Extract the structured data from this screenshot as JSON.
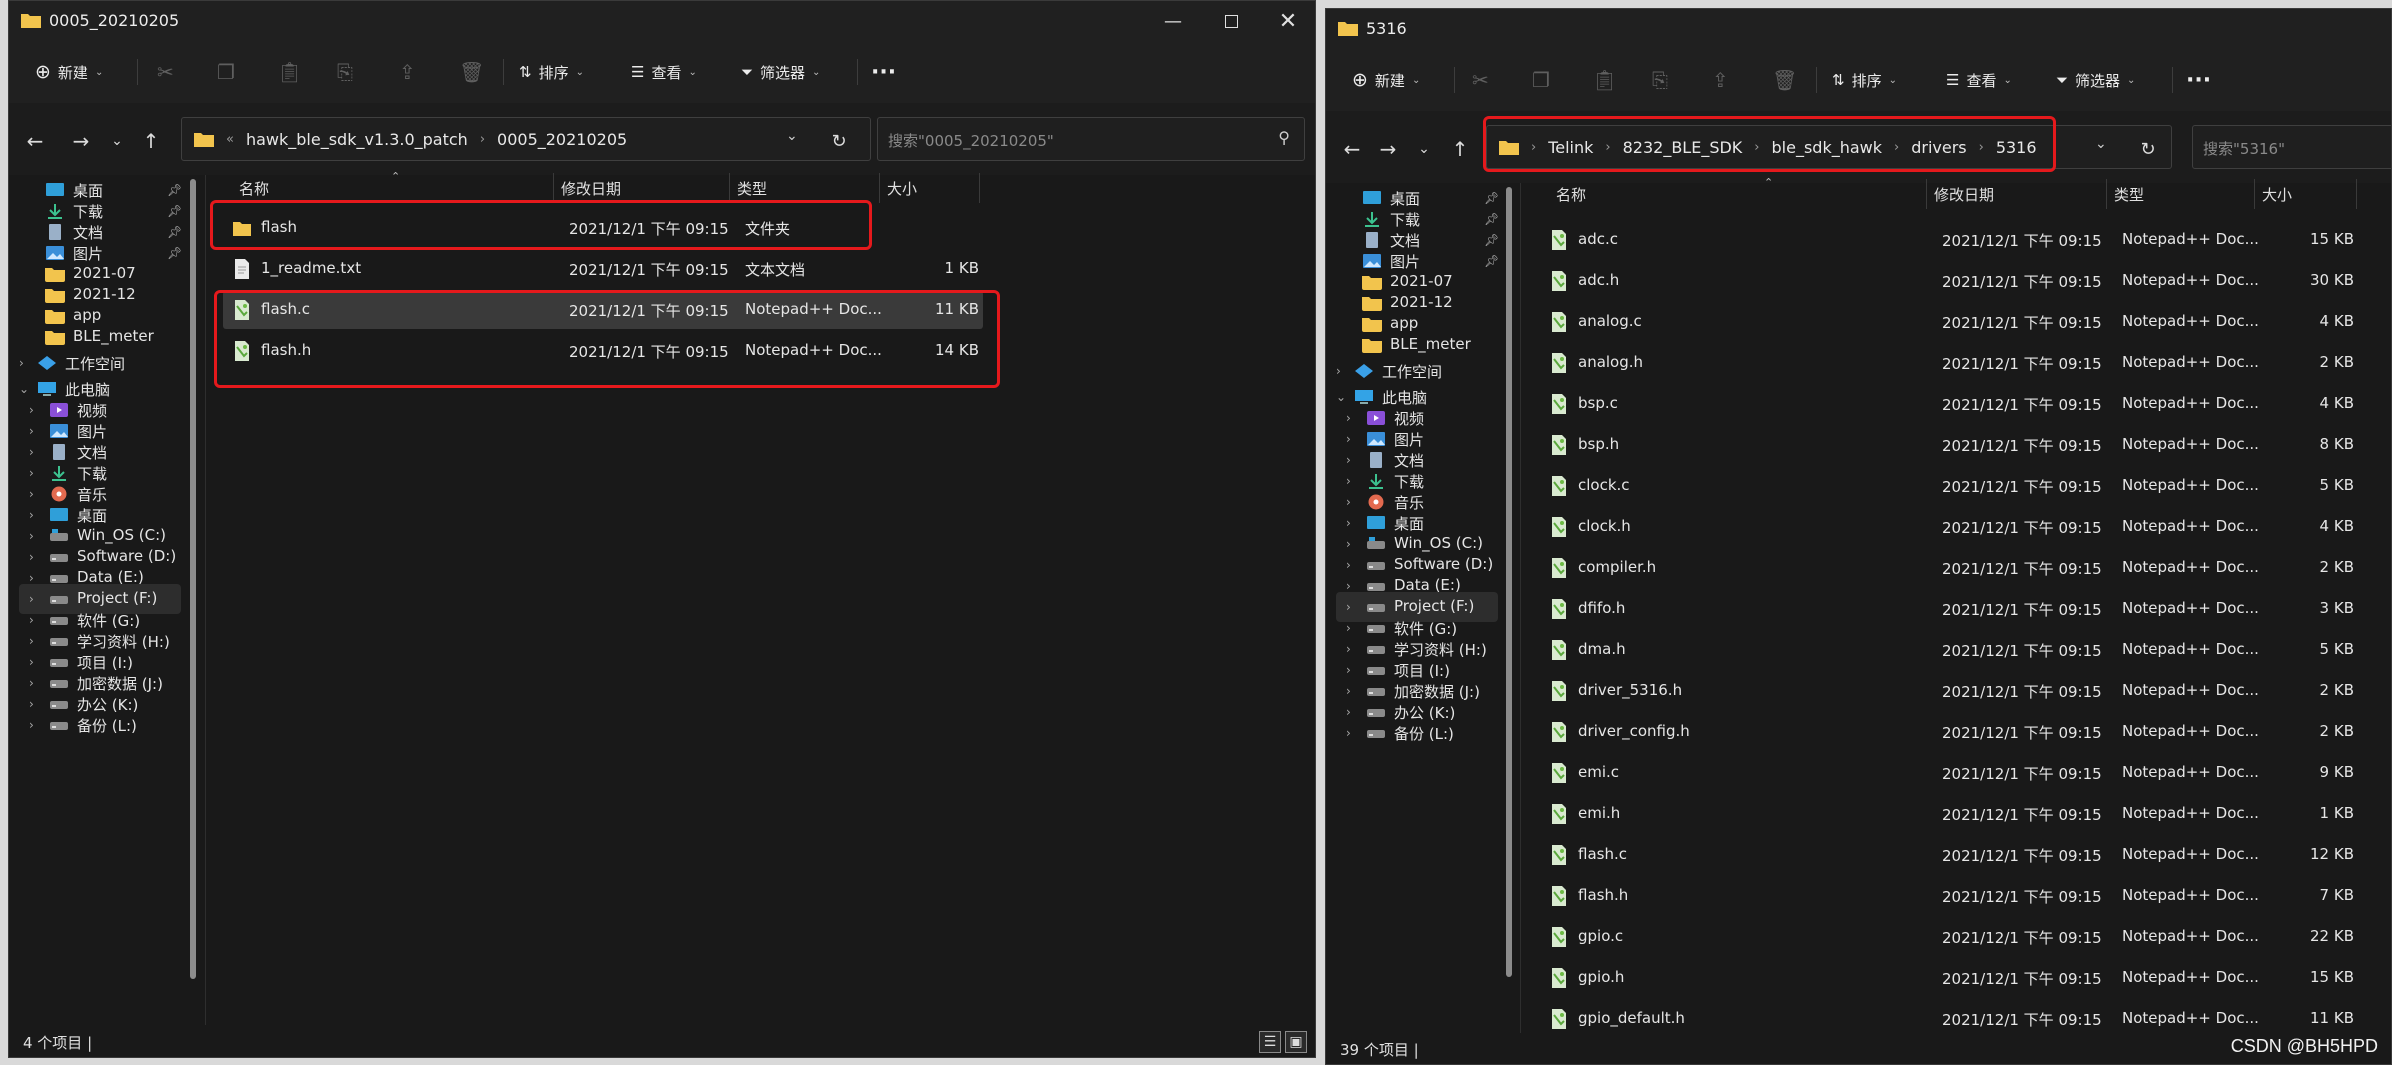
{
  "colors": {
    "window_bg": "#191919",
    "toolbar_bg": "#202020",
    "highlight_border": "#e5191c",
    "folder_yellow": "#f2c44d",
    "selection_bg": "#3a3a3a"
  },
  "left_window": {
    "title": "0005_20210205",
    "title_icon": "folder-icon",
    "window_controls": [
      "minimize-icon",
      "maximize-icon",
      "close-icon"
    ],
    "toolbar": {
      "new_label": "新建",
      "sort_label": "排序",
      "view_label": "查看",
      "filter_label": "筛选器",
      "more_label": "···",
      "disabled_icons": [
        "cut-icon",
        "copy-icon",
        "paste-icon",
        "rename-icon",
        "share-icon",
        "delete-icon"
      ]
    },
    "nav": {
      "back_icon": "arrow-left-icon",
      "forward_icon": "arrow-right-icon",
      "recent_icon": "chevron-down-icon",
      "up_icon": "arrow-up-icon"
    },
    "address": {
      "overflow": "«",
      "crumbs": [
        "hawk_ble_sdk_v1.3.0_patch",
        "0005_20210205"
      ],
      "refresh_icon": "refresh-icon"
    },
    "search": {
      "placeholder": "搜索\"0005_20210205\"",
      "icon": "search-icon"
    },
    "sidebar": [
      {
        "label": "桌面",
        "icon": "desktop-icon",
        "pinned": true
      },
      {
        "label": "下载",
        "icon": "download-icon",
        "pinned": true
      },
      {
        "label": "文档",
        "icon": "document-icon",
        "pinned": true
      },
      {
        "label": "图片",
        "icon": "pictures-icon",
        "pinned": true
      },
      {
        "label": "2021-07",
        "icon": "folder-icon",
        "pinned": false
      },
      {
        "label": "2021-12",
        "icon": "folder-icon",
        "pinned": false
      },
      {
        "label": "app",
        "icon": "folder-icon",
        "pinned": false
      },
      {
        "label": "BLE_meter",
        "icon": "folder-icon",
        "pinned": false
      },
      {
        "label": "工作空间",
        "icon": "workspace-icon",
        "expandable": true
      },
      {
        "label": "此电脑",
        "icon": "pc-icon",
        "expanded": true
      },
      {
        "label": "视频",
        "icon": "videos-icon",
        "expandable": true
      },
      {
        "label": "图片",
        "icon": "pictures-icon",
        "expandable": true
      },
      {
        "label": "文档",
        "icon": "document-icon",
        "expandable": true
      },
      {
        "label": "下载",
        "icon": "download-icon",
        "expandable": true
      },
      {
        "label": "音乐",
        "icon": "music-icon",
        "expandable": true
      },
      {
        "label": "桌面",
        "icon": "desktop-icon",
        "expandable": true
      },
      {
        "label": "Win_OS (C:)",
        "icon": "drive-os-icon",
        "expandable": true
      },
      {
        "label": "Software (D:)",
        "icon": "drive-icon",
        "expandable": true
      },
      {
        "label": "Data (E:)",
        "icon": "drive-icon",
        "expandable": true
      },
      {
        "label": "Project (F:)",
        "icon": "drive-icon",
        "expandable": true,
        "selected": true
      },
      {
        "label": "软件 (G:)",
        "icon": "drive-icon",
        "expandable": true
      },
      {
        "label": "学习资料 (H:)",
        "icon": "drive-icon",
        "expandable": true
      },
      {
        "label": "项目 (I:)",
        "icon": "drive-icon",
        "expandable": true
      },
      {
        "label": "加密数据 (J:)",
        "icon": "drive-icon",
        "expandable": true
      },
      {
        "label": "办公 (K:)",
        "icon": "drive-icon",
        "expandable": true
      },
      {
        "label": "备份 (L:)",
        "icon": "drive-icon",
        "expandable": true
      }
    ],
    "columns": [
      "名称",
      "修改日期",
      "类型",
      "大小"
    ],
    "files": [
      {
        "name": "flash",
        "date": "2021/12/1 下午 09:15",
        "type": "文件夹",
        "size": "",
        "icon": "folder-icon"
      },
      {
        "name": "1_readme.txt",
        "date": "2021/12/1 下午 09:15",
        "type": "文本文档",
        "size": "1 KB",
        "icon": "text-file-icon"
      },
      {
        "name": "flash.c",
        "date": "2021/12/1 下午 09:15",
        "type": "Notepad++ Doc...",
        "size": "11 KB",
        "icon": "notepad-file-icon",
        "selected": true
      },
      {
        "name": "flash.h",
        "date": "2021/12/1 下午 09:15",
        "type": "Notepad++ Doc...",
        "size": "14 KB",
        "icon": "notepad-file-icon"
      }
    ],
    "status": "4 个项目  |"
  },
  "right_window": {
    "title": "5316",
    "title_icon": "folder-icon",
    "toolbar": {
      "new_label": "新建",
      "sort_label": "排序",
      "view_label": "查看",
      "filter_label": "筛选器",
      "more_label": "···",
      "disabled_icons": [
        "cut-icon",
        "copy-icon",
        "paste-icon",
        "rename-icon",
        "share-icon",
        "delete-icon"
      ]
    },
    "nav": {
      "back_icon": "arrow-left-icon",
      "forward_icon": "arrow-right-icon",
      "recent_icon": "chevron-down-icon",
      "up_icon": "arrow-up-icon"
    },
    "address": {
      "crumbs": [
        "Telink",
        "8232_BLE_SDK",
        "ble_sdk_hawk",
        "drivers",
        "5316"
      ],
      "refresh_icon": "refresh-icon"
    },
    "search": {
      "placeholder": "搜索\"5316\""
    },
    "sidebar": [
      {
        "label": "桌面",
        "icon": "desktop-icon",
        "pinned": true
      },
      {
        "label": "下载",
        "icon": "download-icon",
        "pinned": true
      },
      {
        "label": "文档",
        "icon": "document-icon",
        "pinned": true
      },
      {
        "label": "图片",
        "icon": "pictures-icon",
        "pinned": true
      },
      {
        "label": "2021-07",
        "icon": "folder-icon",
        "pinned": false
      },
      {
        "label": "2021-12",
        "icon": "folder-icon",
        "pinned": false
      },
      {
        "label": "app",
        "icon": "folder-icon",
        "pinned": false
      },
      {
        "label": "BLE_meter",
        "icon": "folder-icon",
        "pinned": false
      },
      {
        "label": "工作空间",
        "icon": "workspace-icon",
        "expandable": true
      },
      {
        "label": "此电脑",
        "icon": "pc-icon",
        "expanded": true
      },
      {
        "label": "视频",
        "icon": "videos-icon",
        "expandable": true
      },
      {
        "label": "图片",
        "icon": "pictures-icon",
        "expandable": true
      },
      {
        "label": "文档",
        "icon": "document-icon",
        "expandable": true
      },
      {
        "label": "下载",
        "icon": "download-icon",
        "expandable": true
      },
      {
        "label": "音乐",
        "icon": "music-icon",
        "expandable": true
      },
      {
        "label": "桌面",
        "icon": "desktop-icon",
        "expandable": true
      },
      {
        "label": "Win_OS (C:)",
        "icon": "drive-os-icon",
        "expandable": true
      },
      {
        "label": "Software (D:)",
        "icon": "drive-icon",
        "expandable": true
      },
      {
        "label": "Data (E:)",
        "icon": "drive-icon",
        "expandable": true
      },
      {
        "label": "Project (F:)",
        "icon": "drive-icon",
        "expandable": true,
        "selected": true
      },
      {
        "label": "软件 (G:)",
        "icon": "drive-icon",
        "expandable": true
      },
      {
        "label": "学习资料 (H:)",
        "icon": "drive-icon",
        "expandable": true
      },
      {
        "label": "项目 (I:)",
        "icon": "drive-icon",
        "expandable": true
      },
      {
        "label": "加密数据 (J:)",
        "icon": "drive-icon",
        "expandable": true
      },
      {
        "label": "办公 (K:)",
        "icon": "drive-icon",
        "expandable": true
      },
      {
        "label": "备份 (L:)",
        "icon": "drive-icon",
        "expandable": true
      }
    ],
    "columns": [
      "名称",
      "修改日期",
      "类型",
      "大小"
    ],
    "files": [
      {
        "name": "adc.c",
        "date": "2021/12/1 下午 09:15",
        "type": "Notepad++ Doc...",
        "size": "15 KB"
      },
      {
        "name": "adc.h",
        "date": "2021/12/1 下午 09:15",
        "type": "Notepad++ Doc...",
        "size": "30 KB"
      },
      {
        "name": "analog.c",
        "date": "2021/12/1 下午 09:15",
        "type": "Notepad++ Doc...",
        "size": "4 KB"
      },
      {
        "name": "analog.h",
        "date": "2021/12/1 下午 09:15",
        "type": "Notepad++ Doc...",
        "size": "2 KB"
      },
      {
        "name": "bsp.c",
        "date": "2021/12/1 下午 09:15",
        "type": "Notepad++ Doc...",
        "size": "4 KB"
      },
      {
        "name": "bsp.h",
        "date": "2021/12/1 下午 09:15",
        "type": "Notepad++ Doc...",
        "size": "8 KB"
      },
      {
        "name": "clock.c",
        "date": "2021/12/1 下午 09:15",
        "type": "Notepad++ Doc...",
        "size": "5 KB"
      },
      {
        "name": "clock.h",
        "date": "2021/12/1 下午 09:15",
        "type": "Notepad++ Doc...",
        "size": "4 KB"
      },
      {
        "name": "compiler.h",
        "date": "2021/12/1 下午 09:15",
        "type": "Notepad++ Doc...",
        "size": "2 KB"
      },
      {
        "name": "dfifo.h",
        "date": "2021/12/1 下午 09:15",
        "type": "Notepad++ Doc...",
        "size": "3 KB"
      },
      {
        "name": "dma.h",
        "date": "2021/12/1 下午 09:15",
        "type": "Notepad++ Doc...",
        "size": "5 KB"
      },
      {
        "name": "driver_5316.h",
        "date": "2021/12/1 下午 09:15",
        "type": "Notepad++ Doc...",
        "size": "2 KB"
      },
      {
        "name": "driver_config.h",
        "date": "2021/12/1 下午 09:15",
        "type": "Notepad++ Doc...",
        "size": "2 KB"
      },
      {
        "name": "emi.c",
        "date": "2021/12/1 下午 09:15",
        "type": "Notepad++ Doc...",
        "size": "9 KB"
      },
      {
        "name": "emi.h",
        "date": "2021/12/1 下午 09:15",
        "type": "Notepad++ Doc...",
        "size": "1 KB"
      },
      {
        "name": "flash.c",
        "date": "2021/12/1 下午 09:15",
        "type": "Notepad++ Doc...",
        "size": "12 KB"
      },
      {
        "name": "flash.h",
        "date": "2021/12/1 下午 09:15",
        "type": "Notepad++ Doc...",
        "size": "7 KB"
      },
      {
        "name": "gpio.c",
        "date": "2021/12/1 下午 09:15",
        "type": "Notepad++ Doc...",
        "size": "22 KB"
      },
      {
        "name": "gpio.h",
        "date": "2021/12/1 下午 09:15",
        "type": "Notepad++ Doc...",
        "size": "15 KB"
      },
      {
        "name": "gpio_default.h",
        "date": "2021/12/1 下午 09:15",
        "type": "Notepad++ Doc...",
        "size": "11 KB"
      }
    ],
    "status": "39 个项目  |"
  },
  "watermark": "CSDN @BH5HPD"
}
